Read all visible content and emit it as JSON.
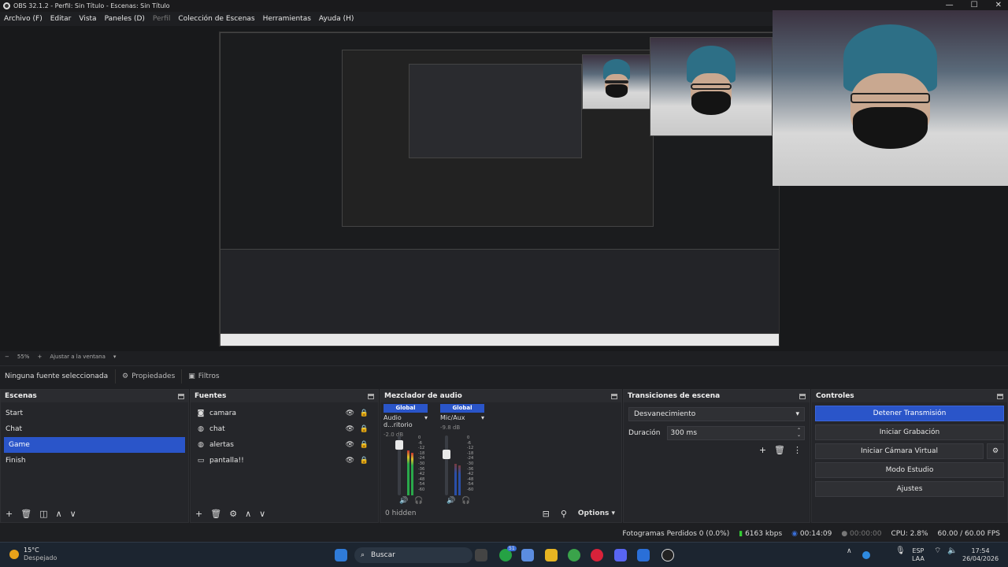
{
  "window": {
    "title": "OBS 32.1.2 - Perfil: Sin Título - Escenas: Sin Título"
  },
  "menu": {
    "items": [
      "Archivo (F)",
      "Editar",
      "Vista",
      "Paneles (D)",
      "Perfil",
      "Colección de Escenas",
      "Herramientas",
      "Ayuda (H)"
    ]
  },
  "zoom": {
    "value": "55%",
    "fit_label": "Ajustar a la ventana"
  },
  "context": {
    "no_source": "Ninguna fuente seleccionada",
    "properties": "Propiedades",
    "filters": "Filtros"
  },
  "scenes": {
    "title": "Escenas",
    "items": [
      "Start",
      "Chat",
      "Game",
      "Finish"
    ],
    "selected_index": 2
  },
  "sources": {
    "title": "Fuentes",
    "items": [
      {
        "name": "camara",
        "icon": "camera-icon"
      },
      {
        "name": "chat",
        "icon": "globe-icon"
      },
      {
        "name": "alertas",
        "icon": "globe-icon"
      },
      {
        "name": "pantalla!!",
        "icon": "monitor-icon"
      }
    ]
  },
  "mixer": {
    "title": "Mezclador de audio",
    "channels": [
      {
        "badge": "Global",
        "name": "Audio d...ritorio",
        "db": "-2.0 dB",
        "level": 0.75
      },
      {
        "badge": "Global",
        "name": "Mic/Aux",
        "db": "-9.8 dB",
        "level": 0.55
      }
    ],
    "scale": [
      "0",
      "-6",
      "-12",
      "-18",
      "-24",
      "-30",
      "-36",
      "-42",
      "-48",
      "-54",
      "-60"
    ],
    "hidden": "0 hidden",
    "options": "Options"
  },
  "transitions": {
    "title": "Transiciones de escena",
    "selected": "Desvanecimiento",
    "duration_label": "Duración",
    "duration_value": "300 ms"
  },
  "controls": {
    "title": "Controles",
    "stop_stream": "Detener Transmisión",
    "start_record": "Iniciar Grabación",
    "virtual_cam": "Iniciar Cámara Virtual",
    "studio_mode": "Modo Estudio",
    "settings": "Ajustes"
  },
  "status": {
    "dropped": "Fotogramas Perdidos 0 (0.0%)",
    "bitrate": "6163 kbps",
    "stream_time": "00:14:09",
    "rec_time": "00:00:00",
    "cpu": "CPU: 2.8%",
    "fps": "60.00 / 60.00 FPS"
  },
  "taskbar": {
    "weather_temp": "15°C",
    "weather_desc": "Despejado",
    "search": "Buscar",
    "lang": "ESP",
    "layout": "LAA",
    "time": "17:54",
    "date": "26/04/2026",
    "badge": "51"
  },
  "colors": {
    "accent": "#2a55c9",
    "panel": "#25262a",
    "bg": "#1e1f22"
  }
}
